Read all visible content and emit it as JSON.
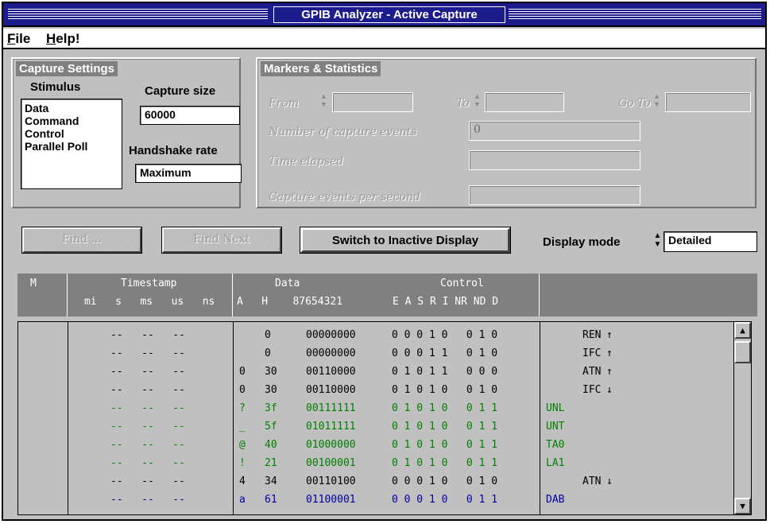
{
  "window": {
    "title": "GPIB Analyzer - Active Capture"
  },
  "menu": {
    "file": "File",
    "file_accel": "F",
    "file_rest": "ile",
    "help_accel": "H",
    "help_rest": "elp!"
  },
  "capture_settings": {
    "title": "Capture Settings",
    "stimulus_label": "Stimulus",
    "stimulus_options": [
      "Data",
      "Command",
      "Control",
      "Parallel Poll"
    ],
    "capture_size_label": "Capture size",
    "capture_size_value": "60000",
    "handshake_label": "Handshake rate",
    "handshake_value": "Maximum"
  },
  "markers": {
    "title": "Markers & Statistics",
    "from_label": "From",
    "to_label": "To",
    "goto_label": "Go To",
    "num_events_label": "Number of capture events",
    "num_events_value": "0",
    "time_elapsed_label": "Time elapsed",
    "events_per_sec_label": "Capture events per second"
  },
  "toolbar": {
    "find_label": "Find ...",
    "find_next_label": "Find Next",
    "switch_label": "Switch to Inactive Display",
    "display_mode_label": "Display mode",
    "display_mode_value": "Detailed"
  },
  "grid": {
    "header": {
      "m": "M",
      "timestamp": "Timestamp",
      "ts_units": "mi   s   ms   us   ns",
      "data": "Data",
      "data_cols": "A   H    87654321",
      "control": "Control",
      "control_cols": "E A S R I NR ND D"
    },
    "colors": {
      "black": "#000000",
      "green": "#008000",
      "blue": "#0000a0"
    },
    "rows": [
      {
        "color": "black",
        "ts": "--   --   --",
        "a": "",
        "h": "0",
        "bits": "00000000",
        "ctl": "0 0 0 1 0   0 1 0",
        "cmd": "",
        "ev": "REN",
        "arrow": "↑"
      },
      {
        "color": "black",
        "ts": "--   --   --",
        "a": "",
        "h": "0",
        "bits": "00000000",
        "ctl": "0 0 0 1 1   0 1 0",
        "cmd": "",
        "ev": "IFC",
        "arrow": "↑"
      },
      {
        "color": "black",
        "ts": "--   --   --",
        "a": "0",
        "h": "30",
        "bits": "00110000",
        "ctl": "0 1 0 1 1   0 0 0",
        "cmd": "",
        "ev": "ATN",
        "arrow": "↑"
      },
      {
        "color": "black",
        "ts": "--   --   --",
        "a": "0",
        "h": "30",
        "bits": "00110000",
        "ctl": "0 1 0 1 0   0 1 0",
        "cmd": "",
        "ev": "IFC",
        "arrow": "↓"
      },
      {
        "color": "green",
        "ts": "--   --   --",
        "a": "?",
        "h": "3f",
        "bits": "00111111",
        "ctl": "0 1 0 1 0   0 1 1",
        "cmd": "UNL",
        "ev": "",
        "arrow": ""
      },
      {
        "color": "green",
        "ts": "--   --   --",
        "a": "_",
        "h": "5f",
        "bits": "01011111",
        "ctl": "0 1 0 1 0   0 1 1",
        "cmd": "UNT",
        "ev": "",
        "arrow": ""
      },
      {
        "color": "green",
        "ts": "--   --   --",
        "a": "@",
        "h": "40",
        "bits": "01000000",
        "ctl": "0 1 0 1 0   0 1 1",
        "cmd": "TA0",
        "ev": "",
        "arrow": ""
      },
      {
        "color": "green",
        "ts": "--   --   --",
        "a": "!",
        "h": "21",
        "bits": "00100001",
        "ctl": "0 1 0 1 0   0 1 1",
        "cmd": "LA1",
        "ev": "",
        "arrow": ""
      },
      {
        "color": "black",
        "ts": "--   --   --",
        "a": "4",
        "h": "34",
        "bits": "00110100",
        "ctl": "0 0 0 1 0   0 1 0",
        "cmd": "",
        "ev": "ATN",
        "arrow": "↓"
      },
      {
        "color": "blue",
        "ts": "--   --   --",
        "a": "a",
        "h": "61",
        "bits": "01100001",
        "ctl": "0 0 0 1 0   0 1 1",
        "cmd": "DAB",
        "ev": "",
        "arrow": ""
      }
    ]
  },
  "scrollbar": {
    "up_icon": "▲",
    "down_icon": "▼"
  }
}
